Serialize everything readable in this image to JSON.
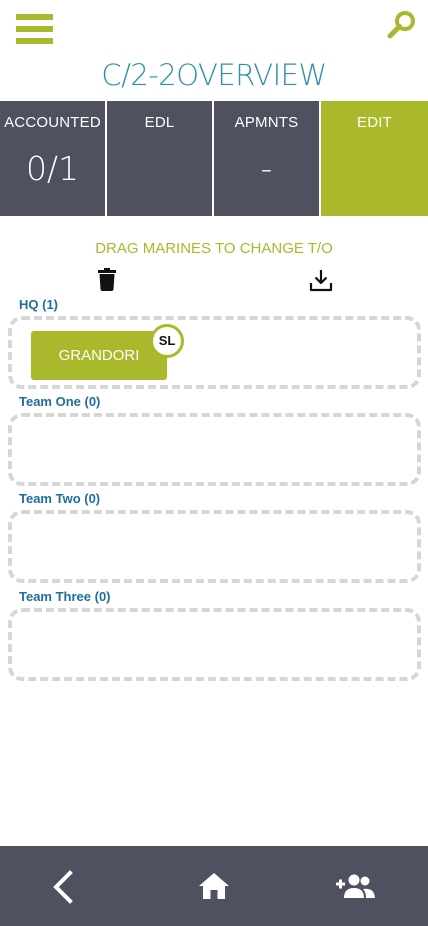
{
  "header": {
    "menu_icon": "hamburger-menu-icon",
    "search_icon": "search-icon",
    "title": "C/2-2OVERVIEW"
  },
  "stats": [
    {
      "label": "ACCOUNTED",
      "value": "0/1"
    },
    {
      "label": "EDL",
      "value": ""
    },
    {
      "label": "APMNTS",
      "value": "-"
    },
    {
      "label": "EDIT",
      "value": ""
    }
  ],
  "instructions": "DRAG MARINES TO CHANGE T/O",
  "actions": {
    "delete_icon": "trash-icon",
    "download_icon": "download-icon"
  },
  "groups": [
    {
      "label": "HQ (1)",
      "members": [
        {
          "name": "GRANDORI",
          "role": "SL"
        }
      ]
    },
    {
      "label": "Team One (0)",
      "members": []
    },
    {
      "label": "Team Two (0)",
      "members": []
    },
    {
      "label": "Team Three (0)",
      "members": []
    }
  ],
  "bottom_nav": {
    "back_icon": "back-chevron-icon",
    "home_icon": "home-icon",
    "add_user_icon": "add-user-icon"
  },
  "colors": {
    "accent": "#a9b92b",
    "title": "#2f8fae",
    "panel": "#4f5160",
    "group_label": "#1f6f9a",
    "dash": "#d6d6d6"
  }
}
